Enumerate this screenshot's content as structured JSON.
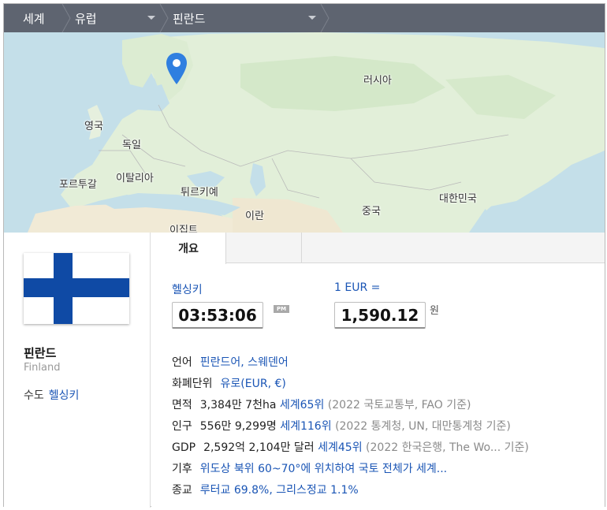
{
  "breadcrumb": {
    "world": "세계",
    "region": "유럽",
    "country": "핀란드"
  },
  "map": {
    "labels": {
      "russia": "러시아",
      "uk": "영국",
      "germany": "독일",
      "portugal": "포르투갈",
      "italy": "이탈리아",
      "turkey": "튀르키예",
      "iran": "이란",
      "egypt": "이집트",
      "china": "중국",
      "korea": "대한민국"
    }
  },
  "country": {
    "name": "핀란드",
    "name_en": "Finland",
    "capital_label": "수도",
    "capital": "헬싱키"
  },
  "tabs": [
    "개요"
  ],
  "clock": {
    "city": "헬싱키",
    "time": "03:53:06",
    "ampm": "PM"
  },
  "currency": {
    "rate_label": "1 EUR =",
    "rate_value": "1,590.12",
    "unit": "원"
  },
  "info": {
    "language": {
      "label": "언어",
      "value": "핀란드어, 스웨덴어"
    },
    "currency": {
      "label": "화폐단위",
      "value": "유로(EUR, €)"
    },
    "area": {
      "label": "면적",
      "value": "3,384만 7천ha",
      "rank": "세계65위",
      "source": "(2022 국토교통부, FAO 기준)"
    },
    "population": {
      "label": "인구",
      "value": "556만 9,299명",
      "rank": "세계116위",
      "source": "(2022 통계청, UN, 대만통계청 기준)"
    },
    "gdp": {
      "label": "GDP",
      "value": "2,592억 2,104만 달러",
      "rank": "세계45위",
      "source": "(2022 한국은행, The Wo...",
      "source_end": " 기준)"
    },
    "climate": {
      "label": "기후",
      "value": "위도상 북위 60~70°에 위치하여 국토 전체가 세계..."
    },
    "religion": {
      "label": "종교",
      "value": "루터교 69.8%, 그리스정교 1.1%"
    }
  },
  "colors": {
    "header_bg": "#5e6470",
    "link": "#1a55b5",
    "flag_blue": "#0f4aa5",
    "map_pin": "#2f7fe0",
    "water": "#c4dfe9",
    "land": "#e2efd9"
  }
}
